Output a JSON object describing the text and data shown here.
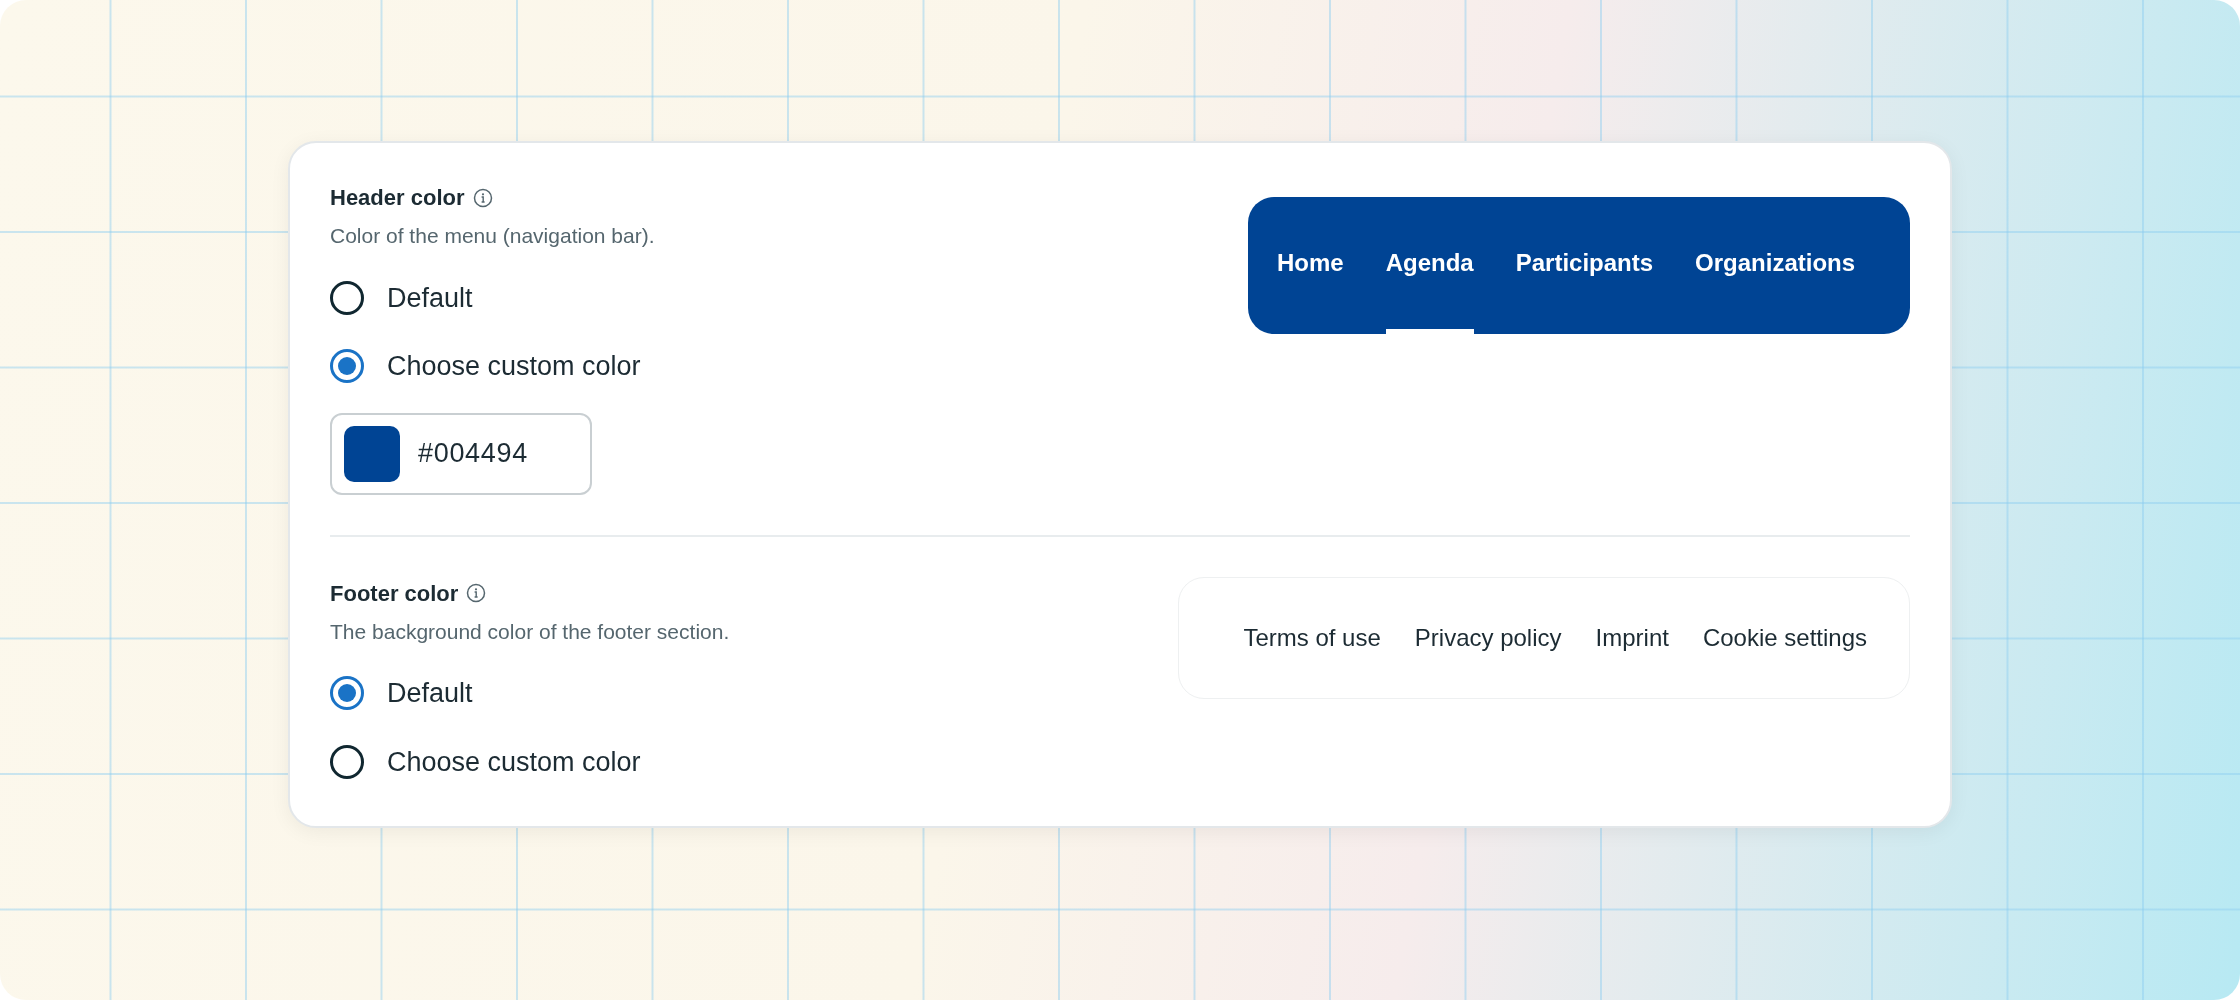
{
  "sections": [
    {
      "title": "Header color",
      "description": "Color of the menu (navigation bar).",
      "options": [
        {
          "label": "Default",
          "selected": false
        },
        {
          "label": "Choose custom color",
          "selected": true
        }
      ],
      "color_field": {
        "value": "#004494",
        "color": "#004494"
      },
      "preview": {
        "kind": "navigation",
        "items": [
          {
            "label": "Home",
            "selected": false
          },
          {
            "label": "Agenda",
            "selected": true
          },
          {
            "label": "Participants",
            "selected": false
          },
          {
            "label": "Organizations",
            "selected": false
          }
        ]
      }
    },
    {
      "title": "Footer color",
      "description": "The background color of the footer section.",
      "options": [
        {
          "label": "Default",
          "selected": true
        },
        {
          "label": "Choose custom color",
          "selected": false
        }
      ],
      "preview": {
        "kind": "footer",
        "items": [
          {
            "label": "Terms of use"
          },
          {
            "label": "Privacy policy"
          },
          {
            "label": "Imprint"
          },
          {
            "label": "Cookie settings"
          }
        ]
      }
    }
  ]
}
